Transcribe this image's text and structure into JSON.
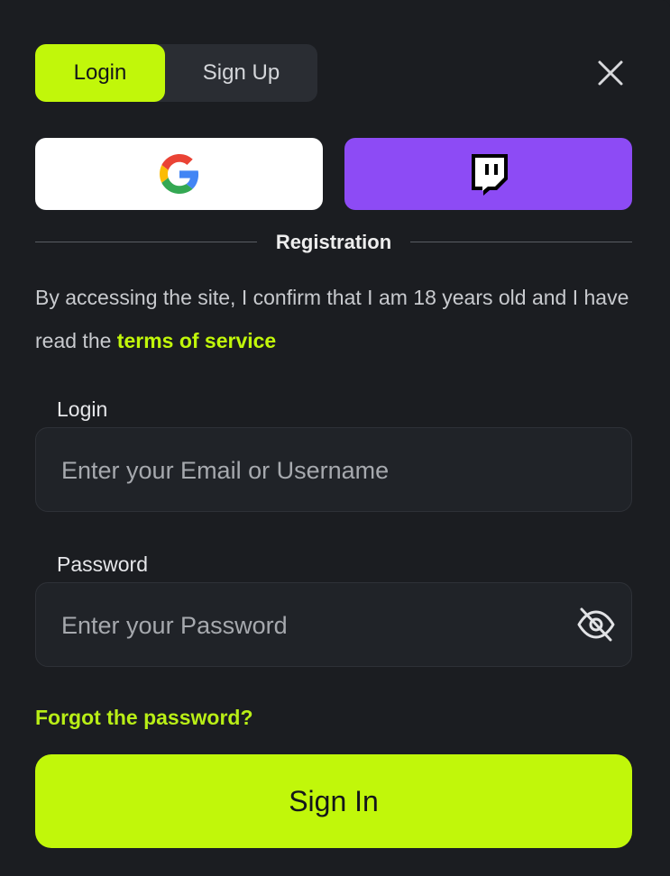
{
  "tabs": {
    "login_label": "Login",
    "signup_label": "Sign Up"
  },
  "divider": {
    "label": "Registration"
  },
  "notice": {
    "text": "By accessing the site, I confirm that I am 18 years old and I have read the ",
    "link": "terms of service"
  },
  "login_field": {
    "label": "Login",
    "placeholder": "Enter your Email or Username"
  },
  "password_field": {
    "label": "Password",
    "placeholder": "Enter your Password"
  },
  "forgot_label": "Forgot the password?",
  "signin_label": "Sign In",
  "colors": {
    "accent": "#c1f70a",
    "twitch": "#8d4bf5",
    "background": "#1b1d21"
  },
  "icons": [
    "close-icon",
    "google-icon",
    "twitch-icon",
    "eye-off-icon"
  ]
}
